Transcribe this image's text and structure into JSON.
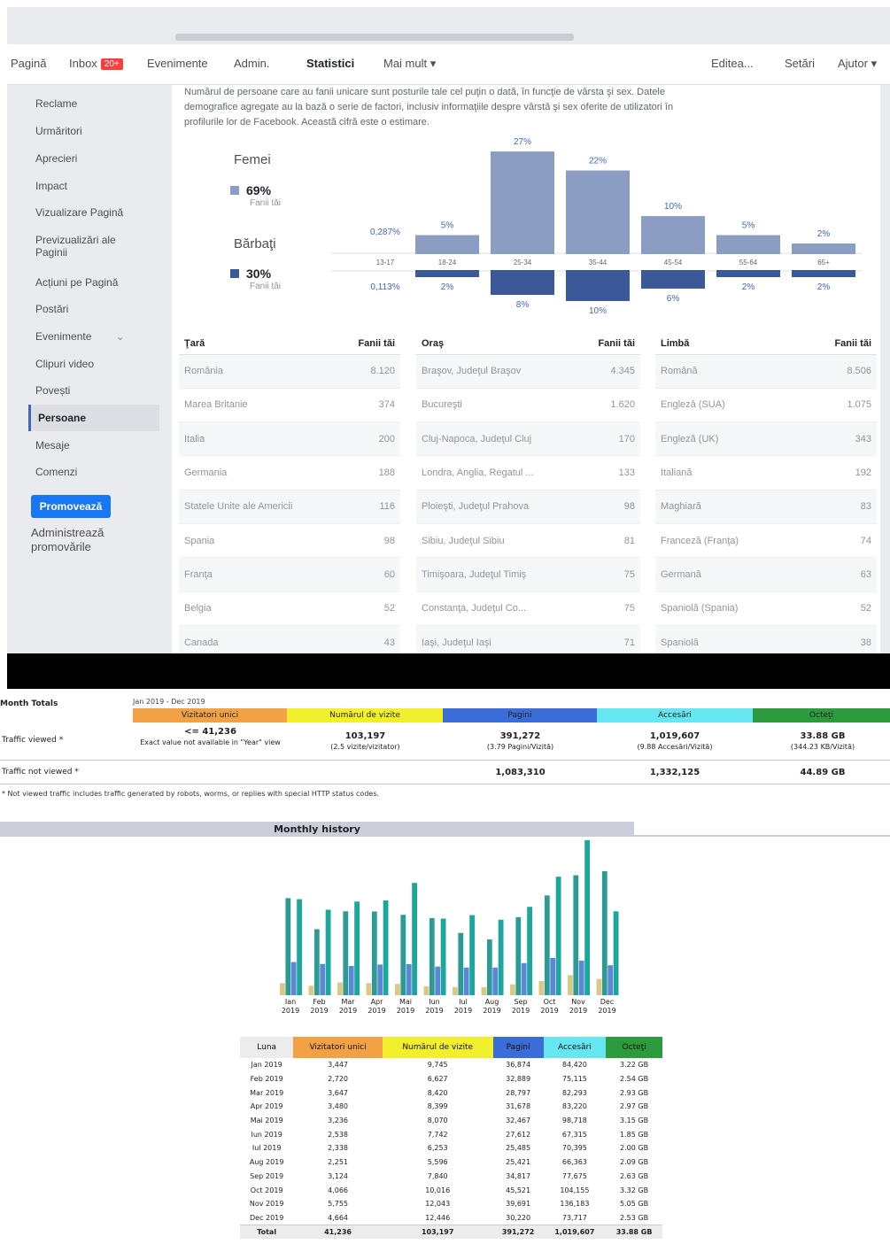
{
  "fb": {
    "nav": {
      "pagina": "Pagină",
      "inbox": "Inbox",
      "inbox_badge": "20+",
      "evenimente": "Evenimente",
      "admin": "Admin.",
      "statistici": "Statistici",
      "mai_mult": "Mai mult ▾",
      "editeaza": "Editea...",
      "setari": "Setări",
      "ajutor": "Ajutor ▾"
    },
    "sidebar": {
      "items": [
        "Reclame",
        "Urmăritori",
        "Aprecieri",
        "Impact",
        "Vizualizare Pagină",
        "Previzualizări ale Paginii",
        "Acțiuni pe Pagină",
        "Postări",
        "Evenimente",
        "Clipuri video",
        "Povești",
        "Persoane",
        "Mesaje",
        "Comenzi"
      ],
      "promote_label": "Promovează",
      "manage_promotions": "Administrează promovările"
    },
    "intro": {
      "line1": "Numărul de persoane care au fanii unicare sunt posturile tale cel puţin o dată, în funcţie de vârsta şi sex. Datele",
      "line2": "demografice agregate au la bază o serie de factori, inclusiv informaţiile despre vârstă şi sex oferite de utilizatori în",
      "line3": "profilurile lor de Facebook. Această cifră este o estimare."
    },
    "female": {
      "label": "Femei",
      "pct": "69%",
      "sub": "Fanii tăi"
    },
    "male": {
      "label": "Bărbaţi",
      "pct": "30%",
      "sub": "Fanii tăi"
    },
    "colors": {
      "female": "#8b9dc3",
      "male": "#3b5998"
    },
    "tables": {
      "tara": {
        "title": "Ţară",
        "col": "Fanii tăi",
        "rows": [
          [
            "România",
            "8.120"
          ],
          [
            "Marea Britanie",
            "374"
          ],
          [
            "Italia",
            "200"
          ],
          [
            "Germania",
            "188"
          ],
          [
            "Statele Unite ale Americii",
            "116"
          ],
          [
            "Spania",
            "98"
          ],
          [
            "Franţa",
            "60"
          ],
          [
            "Belgia",
            "52"
          ],
          [
            "Canada",
            "43"
          ]
        ]
      },
      "oras": {
        "title": "Oraş",
        "col": "Fanii tăi",
        "rows": [
          [
            "Braşov, Judeţul Braşov",
            "4.345"
          ],
          [
            "Bucureşti",
            "1.620"
          ],
          [
            "Cluj-Napoca, Judeţul Cluj",
            "170"
          ],
          [
            "Londra, Anglia, Regatul ...",
            "133"
          ],
          [
            "Ploieşti, Judeţul Prahova",
            "98"
          ],
          [
            "Sibiu, Judeţul Sibiu",
            "81"
          ],
          [
            "Timişoara, Judeţul Timiş",
            "75"
          ],
          [
            "Constanţa, Judeţul Co...",
            "75"
          ],
          [
            "Iaşi, Judeţul Iaşi",
            "71"
          ]
        ]
      },
      "limba": {
        "title": "Limbă",
        "col": "Fanii tăi",
        "rows": [
          [
            "Română",
            "8.506"
          ],
          [
            "Engleză (SUA)",
            "1.075"
          ],
          [
            "Engleză (UK)",
            "343"
          ],
          [
            "Italiană",
            "192"
          ],
          [
            "Maghiară",
            "83"
          ],
          [
            "Franceză (Franţa)",
            "74"
          ],
          [
            "Germană",
            "63"
          ],
          [
            "Spaniolă (Spania)",
            "52"
          ],
          [
            "Spaniolă",
            "38"
          ]
        ]
      }
    }
  },
  "chart_data": [
    {
      "type": "bar",
      "categories": [
        "13-17",
        "18-24",
        "25-34",
        "35-44",
        "45-54",
        "55-64",
        "65+"
      ],
      "series": [
        {
          "name": "Femei",
          "values": [
            0.287,
            5,
            27,
            22,
            10,
            5,
            2
          ],
          "labels": [
            "0,287%",
            "5%",
            "27%",
            "22%",
            "10%",
            "5%",
            "2%"
          ]
        },
        {
          "name": "Bărbaţi",
          "values": [
            0.113,
            2,
            8,
            10,
            6,
            2,
            2
          ],
          "labels": [
            "0,113%",
            "2%",
            "8%",
            "10%",
            "6%",
            "2%",
            "2%"
          ]
        }
      ],
      "ylim": [
        0,
        30
      ]
    },
    {
      "type": "bar",
      "categories": [
        "Jan 2019",
        "Feb 2019",
        "Mar 2019",
        "Apr 2019",
        "Mai 2019",
        "Iun 2019",
        "Iul 2019",
        "Aug 2019",
        "Sep 2019",
        "Oct 2019",
        "Nov 2019",
        "Dec 2019"
      ],
      "tick_labels": [
        [
          "Ian",
          "2019"
        ],
        [
          "Feb",
          "2019"
        ],
        [
          "Mar",
          "2019"
        ],
        [
          "Apr",
          "2019"
        ],
        [
          "Mai",
          "2019"
        ],
        [
          "Iun",
          "2019"
        ],
        [
          "Iul",
          "2019"
        ],
        [
          "Aug",
          "2019"
        ],
        [
          "Sep",
          "2019"
        ],
        [
          "Oct",
          "2019"
        ],
        [
          "Nov",
          "2019"
        ],
        [
          "Dec",
          "2019"
        ]
      ],
      "series": [
        {
          "name": "Vizitatori unici",
          "values": [
            3447,
            2720,
            3647,
            3480,
            3236,
            2538,
            2338,
            2251,
            3124,
            4066,
            5755,
            4664
          ]
        },
        {
          "name": "Numărul de vizite",
          "values": [
            9745,
            6627,
            8420,
            8399,
            8070,
            7742,
            6253,
            5596,
            7840,
            10016,
            12043,
            12446
          ]
        },
        {
          "name": "Pagini",
          "values": [
            36874,
            32889,
            28797,
            31678,
            32467,
            27612,
            25485,
            25421,
            34817,
            45521,
            39691,
            30220
          ]
        },
        {
          "name": "Accesări",
          "values": [
            84420,
            75115,
            82293,
            83220,
            98718,
            67315,
            70395,
            66363,
            77675,
            104155,
            136183,
            73717
          ]
        },
        {
          "name": "Octeţi",
          "values": [
            3.22,
            2.54,
            2.93,
            2.97,
            3.15,
            1.85,
            2.0,
            2.09,
            2.63,
            3.32,
            5.05,
            2.53
          ]
        }
      ],
      "colors": [
        "#f2a245",
        "#f2ef2c",
        "#3b6dd8",
        "#66e6f0",
        "#2b9b3e"
      ],
      "chart_colors": [
        "#dcc886",
        "#2d9a93",
        "#5c86d6",
        "#1ba79b"
      ]
    }
  ],
  "aw": {
    "summary": {
      "left_title": "Month Totals",
      "period_text": "Jan 2019 - Dec 2019",
      "headers": [
        "Vizitatori unici",
        "Numărul de vizite",
        "Pagini",
        "Accesări",
        "Octeţi"
      ],
      "viewed_label": "Traffic viewed *",
      "not_viewed_label": "Traffic not viewed *",
      "visitors": "<= 41,236",
      "visitors_note": "Exact value not available in \"Year\" view",
      "visits": "103,197",
      "visits_note": "(2.5 vizite/vizitator)",
      "pages": "391,272",
      "pages_note": "(3.79 Pagini/Vizită)",
      "hits": "1,019,607",
      "hits_note": "(9.88 Accesări/Vizită)",
      "bytes": "33.88 GB",
      "bytes_note": "(344.23 KB/Vizită)",
      "nv_pages": "1,083,310",
      "nv_hits": "1,332,125",
      "nv_bytes": "44.89 GB",
      "footnote": "* Not viewed traffic includes traffic generated by robots, worms, or replies with special HTTP status codes."
    },
    "monthly_title": "Monthly history",
    "table": {
      "headers": [
        "Luna",
        "Vizitatori unici",
        "Numărul de vizite",
        "Pagini",
        "Accesări",
        "Octeţi"
      ],
      "rows": [
        [
          "Jan 2019",
          "3,447",
          "9,745",
          "36,874",
          "84,420",
          "3.22 GB"
        ],
        [
          "Feb 2019",
          "2,720",
          "6,627",
          "32,889",
          "75,115",
          "2.54 GB"
        ],
        [
          "Mar 2019",
          "3,647",
          "8,420",
          "28,797",
          "82,293",
          "2.93 GB"
        ],
        [
          "Apr 2019",
          "3,480",
          "8,399",
          "31,678",
          "83,220",
          "2.97 GB"
        ],
        [
          "Mai 2019",
          "3,236",
          "8,070",
          "32,467",
          "98,718",
          "3.15 GB"
        ],
        [
          "Iun 2019",
          "2,538",
          "7,742",
          "27,612",
          "67,315",
          "1.85 GB"
        ],
        [
          "Iul 2019",
          "2,338",
          "6,253",
          "25,485",
          "70,395",
          "2.00 GB"
        ],
        [
          "Aug 2019",
          "2,251",
          "5,596",
          "25,421",
          "66,363",
          "2.09 GB"
        ],
        [
          "Sep 2019",
          "3,124",
          "7,840",
          "34,817",
          "77,675",
          "2.63 GB"
        ],
        [
          "Oct 2019",
          "4,066",
          "10,016",
          "45,521",
          "104,155",
          "3.32 GB"
        ],
        [
          "Nov 2019",
          "5,755",
          "12,043",
          "39,691",
          "136,183",
          "5.05 GB"
        ],
        [
          "Dec 2019",
          "4,664",
          "12,446",
          "30,220",
          "73,717",
          "2.53 GB"
        ]
      ],
      "total": [
        "Total",
        "41,236",
        "103,197",
        "391,272",
        "1,019,607",
        "33.88 GB"
      ]
    }
  }
}
